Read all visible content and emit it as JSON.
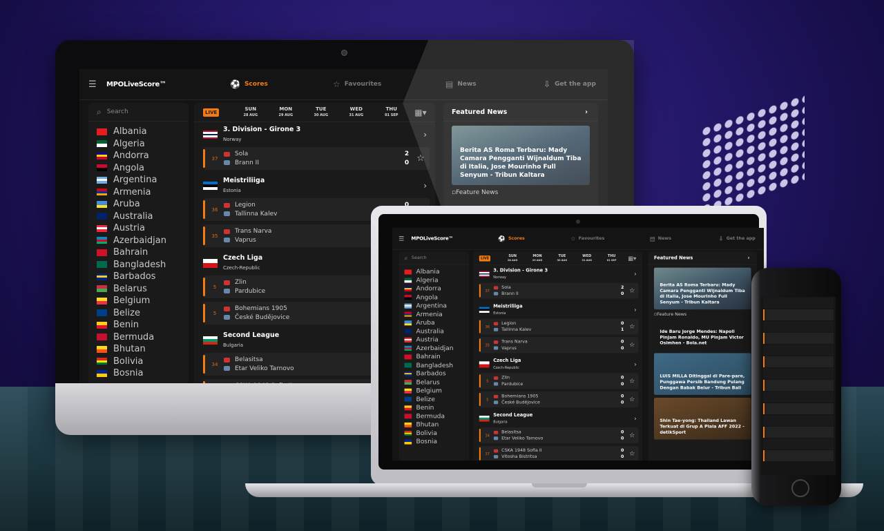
{
  "app": {
    "logo": "MPOLiveScore™",
    "nav": [
      {
        "label": "Scores",
        "icon": "soccer-ball-icon",
        "active": true
      },
      {
        "label": "Favourites",
        "icon": "star-icon"
      },
      {
        "label": "News",
        "icon": "news-icon"
      },
      {
        "label": "Get the app",
        "icon": "download-icon"
      }
    ],
    "search_placeholder": "Search",
    "accent": "#f57c12",
    "countries": [
      {
        "name": "Albania",
        "flag": [
          "#e41e20"
        ]
      },
      {
        "name": "Algeria",
        "flag": [
          "#006233",
          "#ffffff"
        ]
      },
      {
        "name": "Andorra",
        "flag": [
          "#10069f",
          "#fedd00",
          "#d50032"
        ]
      },
      {
        "name": "Angola",
        "flag": [
          "#cc092f",
          "#000000"
        ]
      },
      {
        "name": "Argentina",
        "flag": [
          "#74acdf",
          "#ffffff",
          "#74acdf"
        ]
      },
      {
        "name": "Armenia",
        "flag": [
          "#d90012",
          "#0033a0",
          "#f2a800"
        ]
      },
      {
        "name": "Aruba",
        "flag": [
          "#418fde",
          "#418fde",
          "#fbe122"
        ]
      },
      {
        "name": "Australia",
        "flag": [
          "#012169"
        ]
      },
      {
        "name": "Austria",
        "flag": [
          "#ed2939",
          "#ffffff",
          "#ed2939"
        ]
      },
      {
        "name": "Azerbaidjan",
        "flag": [
          "#0092bc",
          "#e4002b",
          "#00af66"
        ]
      },
      {
        "name": "Bahrain",
        "flag": [
          "#ce1126"
        ]
      },
      {
        "name": "Bangladesh",
        "flag": [
          "#006a4e"
        ]
      },
      {
        "name": "Barbados",
        "flag": [
          "#00267f",
          "#ffc726",
          "#00267f"
        ]
      },
      {
        "name": "Belarus",
        "flag": [
          "#c8313e",
          "#4aa657"
        ]
      },
      {
        "name": "Belgium",
        "flag": [
          "#fdda24",
          "#ef3340"
        ]
      },
      {
        "name": "Belize",
        "flag": [
          "#003f87"
        ]
      },
      {
        "name": "Benin",
        "flag": [
          "#fcd116",
          "#e8112d"
        ]
      },
      {
        "name": "Bermuda",
        "flag": [
          "#c8102e"
        ]
      },
      {
        "name": "Bhutan",
        "flag": [
          "#ffd520",
          "#ff4e12"
        ]
      },
      {
        "name": "Bolivia",
        "flag": [
          "#d52b1e",
          "#f9e300",
          "#007934"
        ]
      },
      {
        "name": "Bosnia",
        "flag": [
          "#002395",
          "#fecb00"
        ]
      }
    ],
    "date_bar": {
      "live": "LIVE",
      "days": [
        {
          "day": "SUN",
          "date": "28 AUG"
        },
        {
          "day": "MON",
          "date": "29 AUG"
        },
        {
          "day": "TUE",
          "date": "30 AUG"
        },
        {
          "day": "WED",
          "date": "31 AUG"
        },
        {
          "day": "THU",
          "date": "01 SEP"
        }
      ]
    },
    "leagues": [
      {
        "name": "3. Division - Girone 3",
        "country": "Norway",
        "flag": [
          "#ba0c2f",
          "#ffffff",
          "#00205b",
          "#ffffff",
          "#ba0c2f"
        ],
        "matches": [
          {
            "minute": "37",
            "home": "Sola",
            "away": "Brann II",
            "home_score": "2",
            "away_score": "0"
          }
        ]
      },
      {
        "name": "Meistriliiga",
        "country": "Estonia",
        "flag": [
          "#0072ce",
          "#000000",
          "#ffffff"
        ],
        "matches": [
          {
            "minute": "36",
            "home": "Legion",
            "away": "Tallinna Kalev",
            "home_score": "0",
            "away_score": "1"
          },
          {
            "minute": "35",
            "home": "Trans Narva",
            "away": "Vaprus",
            "home_score": "0",
            "away_score": "0"
          }
        ]
      },
      {
        "name": "Czech Liga",
        "country": "Czech-Republic",
        "flag": [
          "#ffffff",
          "#d7141a"
        ],
        "matches": [
          {
            "minute": "5",
            "home": "Zlin",
            "away": "Pardubice",
            "home_score": "0",
            "away_score": "0"
          },
          {
            "minute": "5",
            "home": "Bohemians 1905",
            "away": "České Budějovice",
            "home_score": "0",
            "away_score": "0"
          }
        ]
      },
      {
        "name": "Second League",
        "country": "Bulgaria",
        "flag": [
          "#ffffff",
          "#00966e",
          "#d62612"
        ],
        "matches": [
          {
            "minute": "34",
            "home": "Belasitsa",
            "away": "Etar Veliko Tarnovo",
            "home_score": "0",
            "away_score": "0"
          },
          {
            "minute": "37",
            "home": "CSKA 1948 Sofia II",
            "away": "Vitosha Bistritsa",
            "home_score": "0",
            "away_score": "0"
          }
        ]
      }
    ],
    "featured_news": {
      "title": "Featured News",
      "items": [
        {
          "headline": "Berita AS Roma Terbaru: Mady Camara Pengganti Wijnaldum Tiba di Italia, Jose Mourinho Full Senyum - Tribun Kaltara",
          "image": true
        },
        {
          "headline": "Feature News",
          "broken_image": true
        },
        {
          "headline": "Ide Baru Jorge Mendes: Napoli Pinjam Ronaldo, MU Pinjam Victor Osimhen - Bola.net",
          "image": false
        },
        {
          "headline": "LUIS MILLA Ditinggal di Pare-pare, Punggawa Persib Bandung Pulang Dengan Babak Belur - Tribun Bali",
          "image": true
        },
        {
          "headline": "Shin Tae-yong: Thailand Lawan Terkuat di Grup A Piala AFF 2022 - detikSport",
          "image": true
        }
      ]
    }
  }
}
